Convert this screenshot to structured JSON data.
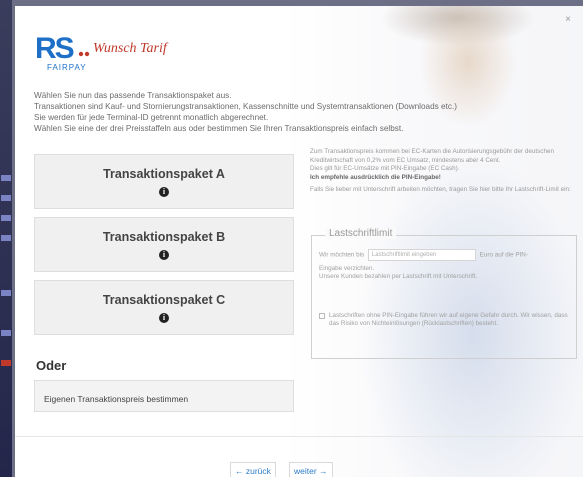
{
  "brand": {
    "logo_text": "RS",
    "logo_sub": "FAIRPAY",
    "signature": "Wunsch Tarif",
    "accent": "#1e6fc8",
    "logo_red": "#c0392b"
  },
  "intro": {
    "line1": "Wählen Sie nun das passende Transaktionspaket aus.",
    "line2": "Transaktionen sind Kauf- und Stornierungstransaktionen, Kassenschnitte und Systemtransaktionen (Downloads etc.)",
    "line3": "Sie werden für jede Terminal-ID getrennt monatlich abgerechnet.",
    "line4": "Wählen Sie eine der drei Preisstaffeln aus oder bestimmen Sie Ihren Transaktionspreis einfach selbst."
  },
  "packages": [
    {
      "label": "Transaktionspaket A",
      "icon": "info-icon"
    },
    {
      "label": "Transaktionspaket B",
      "icon": "info-icon"
    },
    {
      "label": "Transaktionspaket C",
      "icon": "info-icon"
    }
  ],
  "info_glyph": "i",
  "oder": "Oder",
  "own_price_label": "Eigenen Transaktionspreis bestimmen",
  "fees": {
    "p1": "Zum Transaktionspreis kommen bei EC-Karten die Autorisierungsgebühr der deutschen Kreditwirtschaft von 0,2% vom EC Umsatz, mindestens aber 4 Cent.",
    "p2": "Dies gilt für EC-Umsätze mit PIN-Eingabe (EC Cash).",
    "p3": "Ich empfehle ausdrücklich die PIN-Eingabe!",
    "p4": "Falls Sie lieber mit Unterschrift arbeiten möchten, tragen Sie hier bitte Ihr Lastschrift-Limit ein:"
  },
  "limit": {
    "legend": "Lastschriftlimit",
    "prefix": "Wir möchten bis",
    "placeholder": "Lastschriftlimit eingeben",
    "suffix": "Euro auf die PIN-",
    "text1": "Eingabe verzichten.",
    "text2": "Unsere Kunden bezahlen per Lastschrift mit Unterschrift.",
    "checkbox_text": "Lastschriften ohne PIN-Eingabe führen wir auf eigene Gefahr durch. Wir wissen, dass das Risiko von Nichteinlösungen (Rücklastschriften) besteht."
  },
  "nav": {
    "back": "← zurück",
    "next": "weiter →"
  },
  "close_glyph": "×"
}
